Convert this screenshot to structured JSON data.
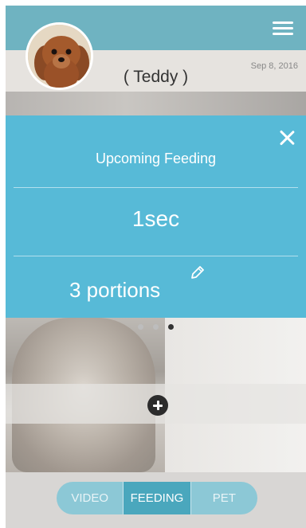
{
  "header": {
    "pet_name": "( Teddy )",
    "date": "Sep 8, 2016",
    "menu_icon": "hamburger-menu-icon",
    "avatar": "dog-avatar"
  },
  "feeding_panel": {
    "title": "Upcoming Feeding",
    "countdown": "1sec",
    "portions": "3 portions",
    "close_icon": "close-icon",
    "edit_icon": "pencil-icon",
    "background_color": "#57bad7"
  },
  "carousel": {
    "page_count": 3,
    "active_index": 2
  },
  "add_icon": "plus-circle-icon",
  "tabs": [
    {
      "label": "VIDEO",
      "active": false
    },
    {
      "label": "FEEDING",
      "active": true
    },
    {
      "label": "PET",
      "active": false
    }
  ],
  "colors": {
    "header": "#6fb3c1",
    "tab_active": "#4aa7bd",
    "tab_inactive": "#8cc8d6"
  }
}
